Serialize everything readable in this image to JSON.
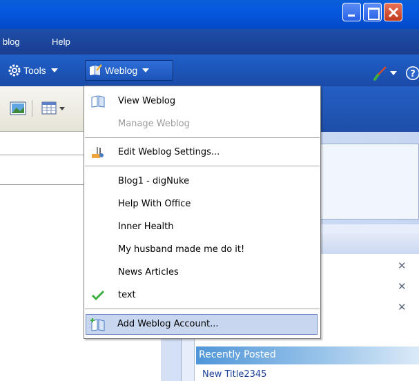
{
  "menubar": {
    "items": [
      {
        "label": "blog"
      },
      {
        "label": "Help"
      }
    ]
  },
  "toolbar": {
    "tools_label": "Tools",
    "weblog_label": "Weblog"
  },
  "dropdown": {
    "items": [
      {
        "label": "View Weblog",
        "icon": "book-icon",
        "enabled": true
      },
      {
        "label": "Manage Weblog",
        "icon": "",
        "enabled": false
      },
      {
        "label": "Edit Weblog Settings...",
        "icon": "settings-icon",
        "enabled": true
      },
      {
        "label": "Blog1 - digNuke",
        "enabled": true
      },
      {
        "label": "Help With Office",
        "enabled": true
      },
      {
        "label": "Inner Health",
        "enabled": true
      },
      {
        "label": "My husband made me do it!",
        "enabled": true
      },
      {
        "label": "News Articles",
        "enabled": true
      },
      {
        "label": "text",
        "enabled": true,
        "checked": true
      },
      {
        "label": "Add Weblog Account...",
        "icon": "add-book-icon",
        "enabled": true,
        "highlighted": true
      }
    ]
  },
  "sidepanel": {
    "recent_header": "Recently Posted",
    "recent_items": [
      "New Title2345"
    ]
  },
  "colors": {
    "titlebar": "#0758de",
    "menubar": "#1e4fa8",
    "highlight": "#c8d6f0",
    "check": "#3cb043"
  }
}
